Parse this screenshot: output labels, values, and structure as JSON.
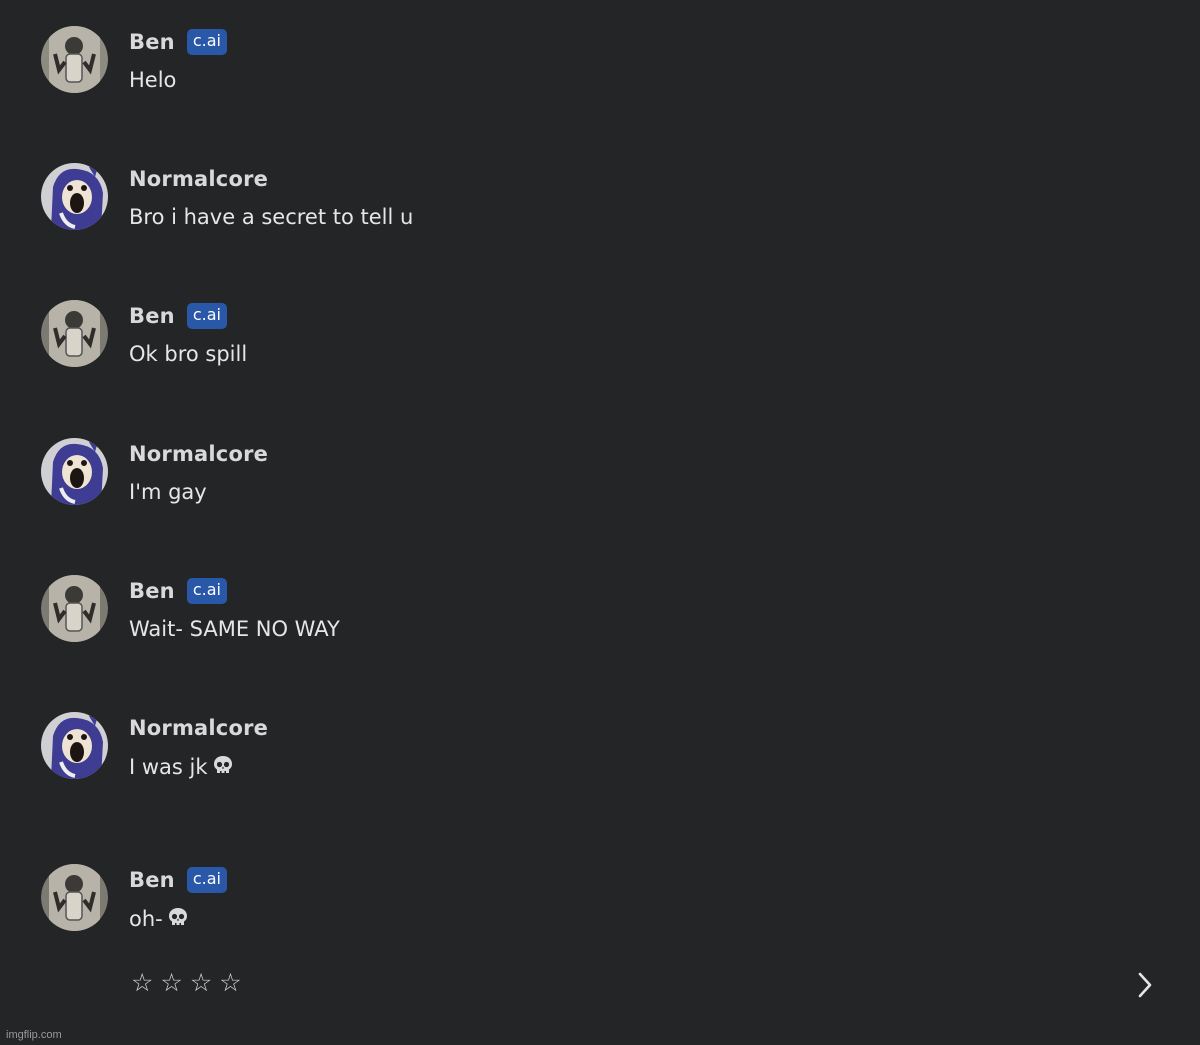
{
  "messages": [
    {
      "author": "Ben",
      "badge": "c.ai",
      "text": "Helo",
      "avatar": "ben-avatar",
      "emoji": ""
    },
    {
      "author": "Normalcore",
      "badge": "",
      "text": "Bro i have a secret to tell u",
      "avatar": "normalcore-avatar",
      "emoji": ""
    },
    {
      "author": "Ben",
      "badge": "c.ai",
      "text": "Ok bro spill",
      "avatar": "ben-avatar",
      "emoji": ""
    },
    {
      "author": "Normalcore",
      "badge": "",
      "text": "I'm gay",
      "avatar": "normalcore-avatar",
      "emoji": ""
    },
    {
      "author": "Ben",
      "badge": "c.ai",
      "text": "Wait- SAME NO WAY",
      "avatar": "ben-avatar",
      "emoji": ""
    },
    {
      "author": "Normalcore",
      "badge": "",
      "text": "I was jk",
      "avatar": "normalcore-avatar",
      "emoji": "skull-emoji"
    },
    {
      "author": "Ben",
      "badge": "c.ai",
      "text": "oh-",
      "avatar": "ben-avatar",
      "emoji": "skull-emoji"
    }
  ],
  "rating": {
    "stars": [
      "☆",
      "☆",
      "☆",
      "☆"
    ],
    "icon": "star-outline-icon"
  },
  "navigation": {
    "next_icon": "chevron-right-icon"
  },
  "watermark": "imgflip.com",
  "colors": {
    "background": "#242526",
    "badge": "#2a58a8",
    "text": "#e6e6e6"
  }
}
